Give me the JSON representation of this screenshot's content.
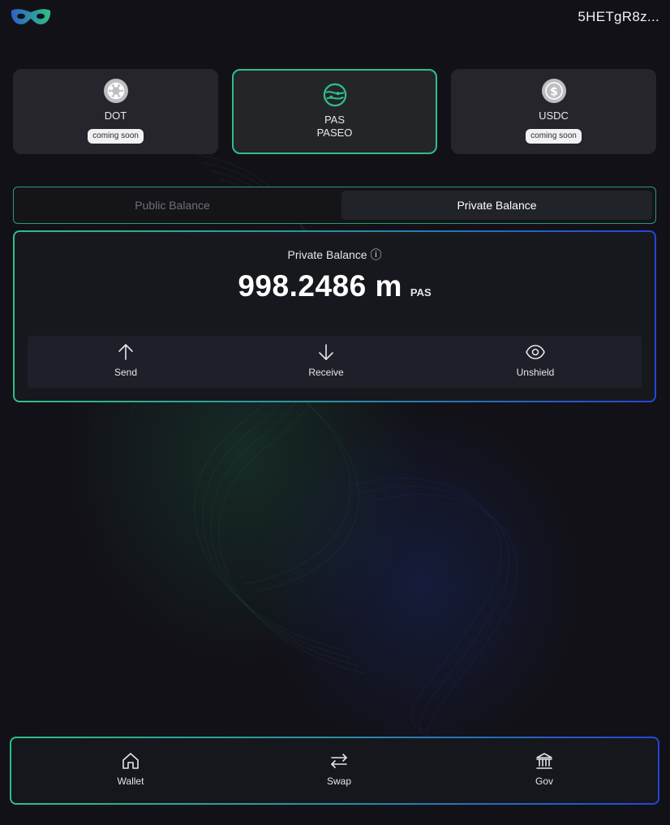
{
  "header": {
    "account_address": "5HETgR8z...",
    "logo_icon": "mask-logo-icon"
  },
  "tokens": [
    {
      "symbol": "DOT",
      "network": "",
      "badge": "coming soon",
      "icon": "polkadot-icon",
      "selected": false
    },
    {
      "symbol": "PAS",
      "network": "PASEO",
      "badge": "",
      "icon": "paseo-icon",
      "selected": true
    },
    {
      "symbol": "USDC",
      "network": "",
      "badge": "coming soon",
      "icon": "dollar-coin-icon",
      "selected": false
    }
  ],
  "balance_tabs": {
    "public_label": "Public Balance",
    "private_label": "Private Balance",
    "active": "Private Balance"
  },
  "balance_card": {
    "title": "Private Balance",
    "info_glyph": "ⓘ",
    "amount": "998.2486 m",
    "unit": "PAS",
    "actions": [
      {
        "label": "Send",
        "icon": "arrow-up-icon"
      },
      {
        "label": "Receive",
        "icon": "arrow-down-icon"
      },
      {
        "label": "Unshield",
        "icon": "eye-icon"
      }
    ]
  },
  "bottom_nav": {
    "items": [
      {
        "label": "Wallet",
        "icon": "home-icon"
      },
      {
        "label": "Swap",
        "icon": "swap-arrows-icon"
      },
      {
        "label": "Gov",
        "icon": "bank-icon"
      }
    ]
  },
  "colors": {
    "background": "#121117",
    "accent_green": "#2fbf85",
    "accent_blue": "#2346d8",
    "card": "#26252b"
  }
}
